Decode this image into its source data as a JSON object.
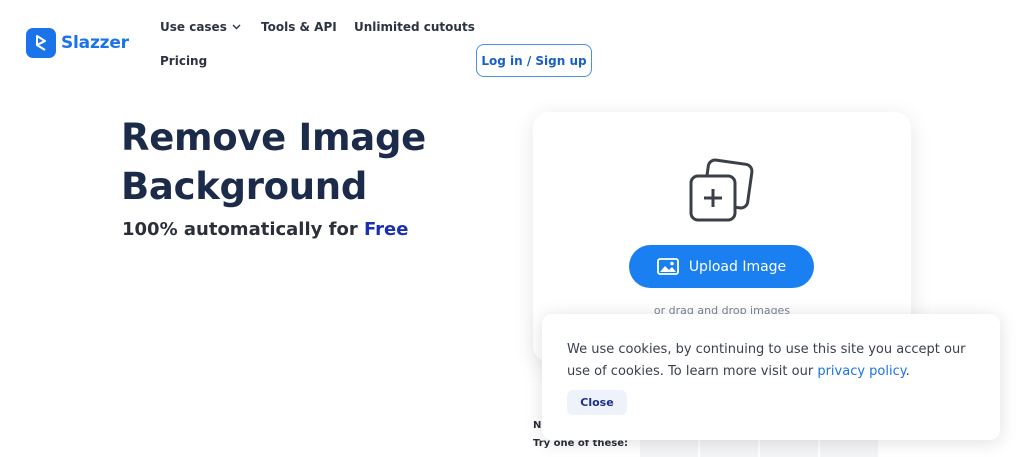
{
  "brand": {
    "name": "Slazzer",
    "color": "#1a73e8"
  },
  "nav": {
    "use_cases": "Use cases",
    "tools_api": "Tools & API",
    "unlimited_cutouts": "Unlimited cutouts",
    "pricing": "Pricing",
    "login": "Log in / Sign up"
  },
  "hero": {
    "title_line1": "Remove Image",
    "title_line2": "Background",
    "subtitle_prefix": "100% automatically for ",
    "subtitle_free": "Free"
  },
  "upload": {
    "button_label": "Upload Image",
    "drag_text": "or drag and drop images",
    "icon": "add-image-stack-icon"
  },
  "below": {
    "partial_text": "N",
    "try_text": "Try one of these:"
  },
  "cookie": {
    "text_prefix": "We use cookies, by continuing to use this site you accept our use of cookies.  To learn more visit our ",
    "link": "privacy policy",
    "text_suffix": ".",
    "close_label": "Close"
  },
  "colors": {
    "accent": "#1a7ff0",
    "heading": "#1c2b4a",
    "free_highlight": "#1b2fb3"
  }
}
